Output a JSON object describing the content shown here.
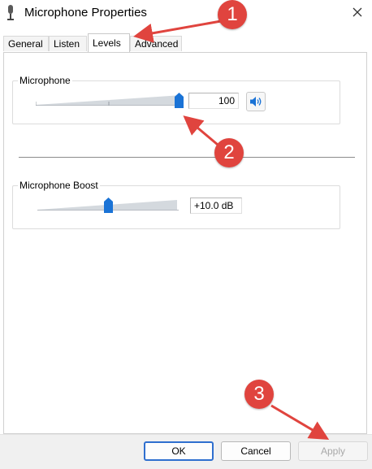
{
  "window": {
    "title": "Microphone Properties",
    "close_glyph": "✕"
  },
  "tabs": [
    {
      "label": "General",
      "active": false
    },
    {
      "label": "Listen",
      "active": false
    },
    {
      "label": "Levels",
      "active": true
    },
    {
      "label": "Advanced",
      "active": false
    }
  ],
  "levels": {
    "microphone": {
      "label": "Microphone",
      "value": "100",
      "level": 1.0
    },
    "boost": {
      "label": "Microphone Boost",
      "value": "+10.0 dB",
      "level": 0.5
    }
  },
  "footer": {
    "ok_label": "OK",
    "cancel_label": "Cancel",
    "apply_label": "Apply"
  },
  "annotations": [
    "1",
    "2",
    "3"
  ],
  "colors": {
    "annotation": "#e0443e",
    "accent": "#1a73d6",
    "primary_border": "#2f6fcf"
  }
}
